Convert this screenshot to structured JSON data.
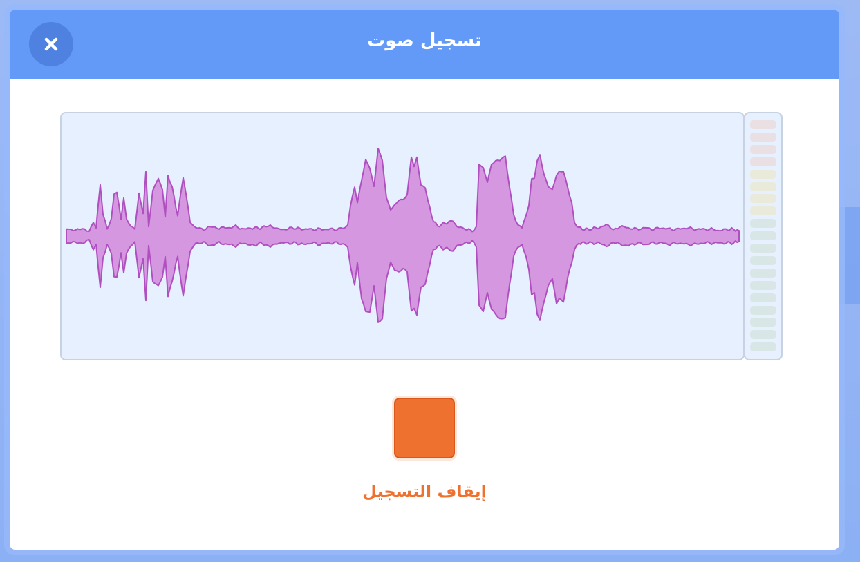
{
  "dialog": {
    "title": "تسجيل صوت",
    "close_icon": "close-icon"
  },
  "recording": {
    "stop_label": "إيقاف التسجيل",
    "stop_icon": "stop-square-icon",
    "state": "recording"
  },
  "level_meter": {
    "segment_count": 19,
    "active_segments": 0
  },
  "colors": {
    "header": "#6399f7",
    "accent": "#ef7130",
    "waveform_fill": "#d597df",
    "waveform_stroke": "#b04fc0",
    "panel_bg": "#e6f0ff"
  }
}
